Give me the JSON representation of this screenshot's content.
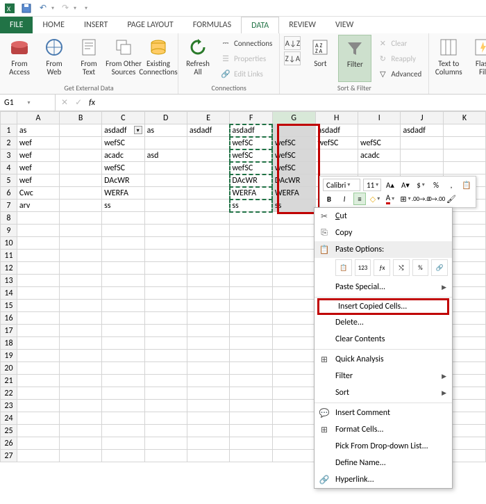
{
  "qat": {
    "save": "save",
    "undo": "undo",
    "redo": "redo"
  },
  "tabs": {
    "file": "FILE",
    "home": "HOME",
    "insert": "INSERT",
    "pagelayout": "PAGE LAYOUT",
    "formulas": "FORMULAS",
    "data": "DATA",
    "review": "REVIEW",
    "view": "VIEW"
  },
  "ribbon": {
    "external": {
      "access": "From\nAccess",
      "web": "From\nWeb",
      "text": "From\nText",
      "other": "From Other\nSources",
      "existing": "Existing\nConnections",
      "label": "Get External Data"
    },
    "connections": {
      "refresh": "Refresh\nAll",
      "connections": "Connections",
      "properties": "Properties",
      "editlinks": "Edit Links",
      "label": "Connections"
    },
    "sort": {
      "sort": "Sort",
      "filter": "Filter",
      "clear": "Clear",
      "reapply": "Reapply",
      "advanced": "Advanced",
      "label": "Sort & Filter"
    },
    "tools": {
      "t2c": "Text to\nColumns",
      "flash": "Flash\nFill"
    }
  },
  "formula_bar": {
    "cell": "G1"
  },
  "columns": [
    "A",
    "B",
    "C",
    "D",
    "E",
    "F",
    "G",
    "H",
    "I",
    "J",
    "K"
  ],
  "rows": [
    1,
    2,
    3,
    4,
    5,
    6,
    7,
    8,
    9,
    10,
    11,
    12,
    13,
    14,
    15,
    16,
    17,
    18,
    19,
    20,
    21,
    22,
    23,
    24,
    25,
    26,
    27
  ],
  "cells": {
    "1": {
      "A": "as",
      "C": "asdadf",
      "D": "as",
      "E": "asdadf",
      "F": "asdadf",
      "H": "asdadf",
      "J": "asdadf"
    },
    "2": {
      "A": "wef",
      "C": "wefSC",
      "F": "wefSC",
      "G": "wefSC",
      "H": "wefSC",
      "I": "wefSC"
    },
    "3": {
      "A": "wef",
      "C": "acadc",
      "D": "asd",
      "F": "wefSC",
      "G": "wefSC",
      "I": "acadc"
    },
    "4": {
      "A": "wef",
      "C": "wefSC",
      "F": "wefSC",
      "G": "wefSC"
    },
    "5": {
      "A": "wef",
      "C": "DAcWR",
      "F": "DAcWR",
      "G": "DAcWR"
    },
    "6": {
      "A": "Cwc",
      "C": "WERFA",
      "F": "WERFA",
      "G": "WERFA"
    },
    "7": {
      "A": "arv",
      "C": "ss",
      "F": "ss",
      "G": "ss"
    }
  },
  "mini_toolbar": {
    "font": "Calibri",
    "size": "11",
    "currency": "$",
    "percent": "%",
    "comma": ","
  },
  "context_menu": {
    "cut": "Cut",
    "copy": "Copy",
    "paste_options": "Paste Options:",
    "paste_special": "Paste Special...",
    "insert_copied": "Insert Copied Cells...",
    "delete": "Delete...",
    "clear": "Clear Contents",
    "quick": "Quick Analysis",
    "filter": "Filter",
    "sort": "Sort",
    "comment": "Insert Comment",
    "format": "Format Cells...",
    "pick": "Pick From Drop-down List...",
    "define": "Define Name...",
    "hyperlink": "Hyperlink...",
    "paste_123": "123"
  }
}
